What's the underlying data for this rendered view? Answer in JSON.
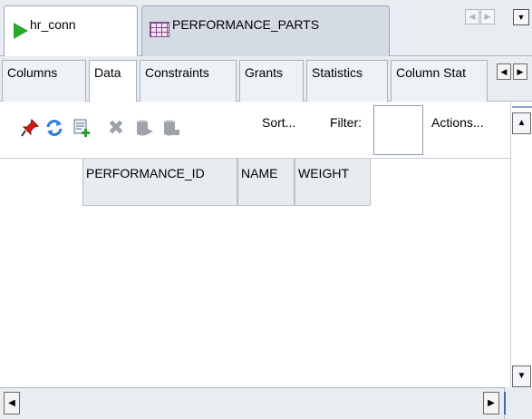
{
  "doc_tabs": {
    "connection": "hr_conn",
    "table": "PERFORMANCE_PARTS"
  },
  "sub_tabs": [
    "Columns",
    "Data",
    "Constraints",
    "Grants",
    "Statistics",
    "Column Stat"
  ],
  "active_sub_tab": "Data",
  "toolbar": {
    "sort_label": "Sort...",
    "filter_label": "Filter:",
    "filter_value": "",
    "actions_label": "Actions...",
    "icons": [
      "pin-icon",
      "refresh-icon",
      "insert-row-icon",
      "delete-row-icon",
      "commit-icon",
      "rollback-icon"
    ]
  },
  "grid": {
    "columns": [
      "PERFORMANCE_ID",
      "NAME",
      "WEIGHT"
    ],
    "rows": []
  },
  "colors": {
    "run_triangle": "#2aa82a",
    "pin": "#d81818",
    "refresh": "#2f7ed8",
    "insert": "#2e9d2e",
    "disabled": "#9ea3aa"
  }
}
